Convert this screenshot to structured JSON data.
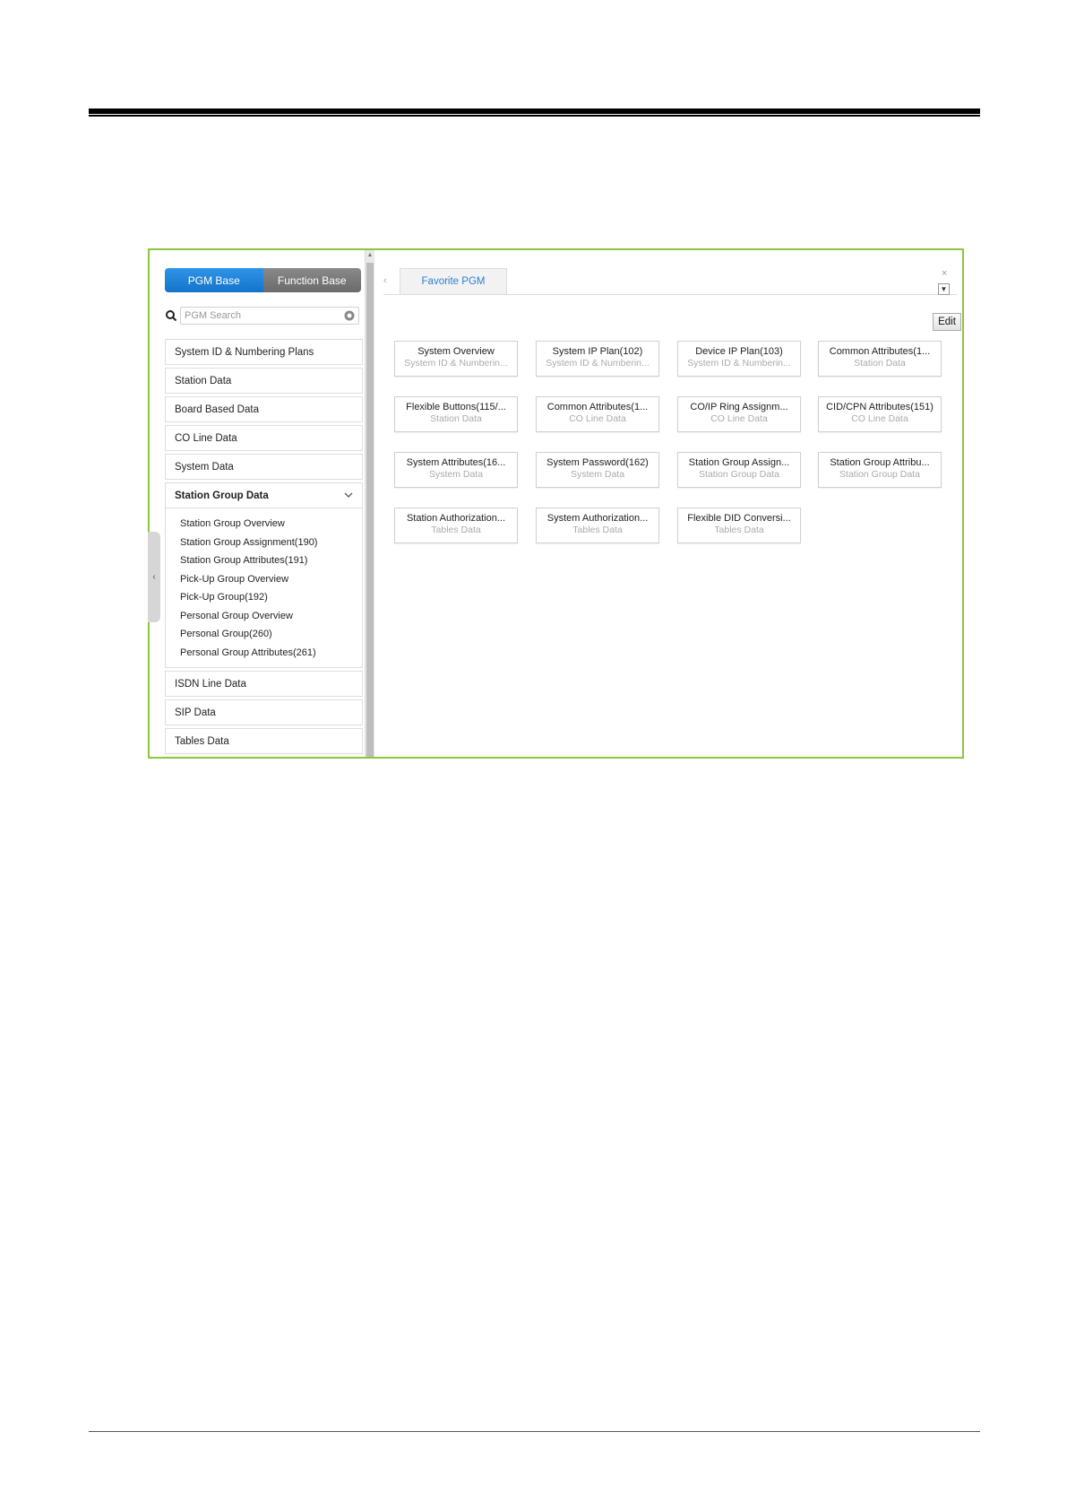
{
  "segment": {
    "pgm_base": "PGM Base",
    "function_base": "Function Base"
  },
  "search": {
    "placeholder": "PGM Search"
  },
  "nav": {
    "items_before": [
      "System ID & Numbering Plans",
      "Station Data",
      "Board Based Data",
      "CO Line Data",
      "System Data"
    ],
    "expanded": {
      "label": "Station Group Data",
      "children": [
        "Station Group Overview",
        "Station Group Assignment(190)",
        "Station Group Attributes(191)",
        "Pick-Up Group Overview",
        "Pick-Up Group(192)",
        "Personal Group Overview",
        "Personal Group(260)",
        "Personal Group Attributes(261)"
      ]
    },
    "items_after": [
      "ISDN Line Data",
      "SIP Data",
      "Tables Data"
    ]
  },
  "tabs": {
    "favorite": "Favorite PGM"
  },
  "toolbar": {
    "edit_label": "Edit"
  },
  "cards": [
    {
      "title": "System Overview",
      "subtitle": "System ID & Numberin..."
    },
    {
      "title": "System IP Plan(102)",
      "subtitle": "System ID & Numberin..."
    },
    {
      "title": "Device IP Plan(103)",
      "subtitle": "System ID & Numberin..."
    },
    {
      "title": "Common Attributes(1...",
      "subtitle": "Station Data"
    },
    {
      "title": "Flexible Buttons(115/...",
      "subtitle": "Station Data"
    },
    {
      "title": "Common Attributes(1...",
      "subtitle": "CO Line Data"
    },
    {
      "title": "CO/IP Ring Assignm...",
      "subtitle": "CO Line Data"
    },
    {
      "title": "CID/CPN Attributes(151)",
      "subtitle": "CO Line Data"
    },
    {
      "title": "System Attributes(16...",
      "subtitle": "System Data"
    },
    {
      "title": "System Password(162)",
      "subtitle": "System Data"
    },
    {
      "title": "Station Group Assign...",
      "subtitle": "Station Group Data"
    },
    {
      "title": "Station Group Attribu...",
      "subtitle": "Station Group Data"
    },
    {
      "title": "Station Authorization...",
      "subtitle": "Tables Data"
    },
    {
      "title": "System Authorization...",
      "subtitle": "Tables Data"
    },
    {
      "title": "Flexible DID Conversi...",
      "subtitle": "Tables Data"
    }
  ],
  "colors": {
    "accent_blue": "#1f86dc",
    "frame_green": "#8cc63f",
    "tab_text": "#2a7fd4"
  },
  "icons": {
    "search": "search-icon",
    "clear": "clear-icon",
    "expand": "chevron-down-icon",
    "collapse": "chevron-left-icon",
    "close": "close-icon",
    "dropdown": "dropdown-icon"
  }
}
